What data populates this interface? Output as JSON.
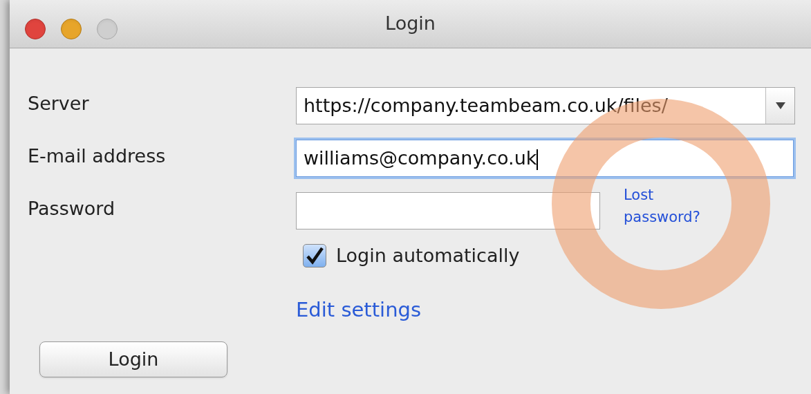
{
  "window": {
    "title": "Login",
    "buttons": [
      {
        "kind": "close",
        "disabled": false
      },
      {
        "kind": "minimize",
        "disabled": false
      },
      {
        "kind": "zoom",
        "disabled": true
      }
    ]
  },
  "fields": [
    {
      "label": "Server",
      "kind": "combo",
      "value": "https://company.teambeam.co.uk/files/",
      "focused": false
    },
    {
      "label": "E-mail address",
      "kind": "text",
      "value": "williams@company.co.uk",
      "focused": true
    },
    {
      "label": "Password",
      "kind": "password",
      "focused": false,
      "link": "Lost password?"
    }
  ],
  "checkbox": {
    "label": "Login automatically",
    "checked": true
  },
  "settings_link": "Edit settings",
  "button": "Login",
  "annotations": [
    {
      "kind": "ring"
    }
  ]
}
